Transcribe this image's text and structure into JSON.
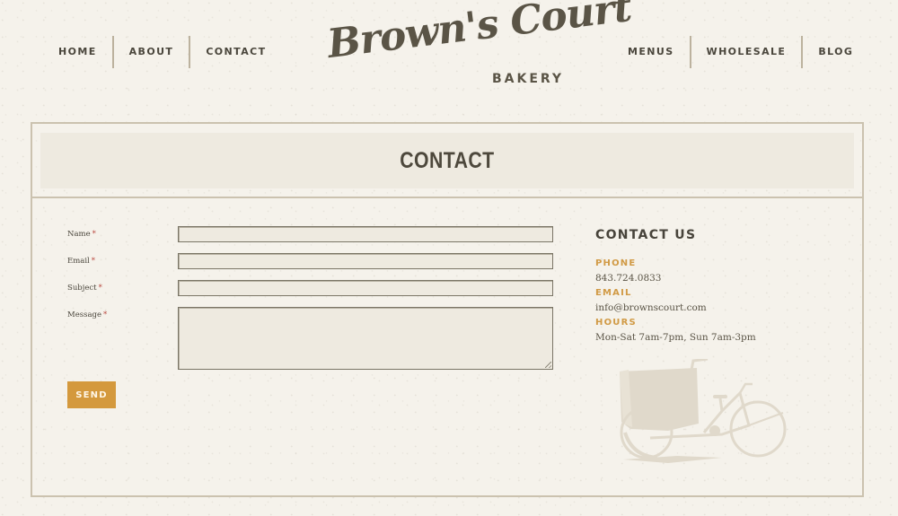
{
  "header": {
    "nav_left": [
      {
        "label": "HOME"
      },
      {
        "label": "ABOUT"
      },
      {
        "label": "CONTACT"
      }
    ],
    "nav_right": [
      {
        "label": "MENUS"
      },
      {
        "label": "WHOLESALE"
      },
      {
        "label": "BLOG"
      }
    ],
    "logo": {
      "script": "Brown's Court",
      "sub": "BAKERY"
    }
  },
  "page": {
    "title": "CONTACT"
  },
  "form": {
    "required_marker": "*",
    "fields": [
      {
        "label": "Name",
        "value": ""
      },
      {
        "label": "Email",
        "value": ""
      },
      {
        "label": "Subject",
        "value": ""
      },
      {
        "label": "Message",
        "value": ""
      }
    ],
    "submit_label": "SEND"
  },
  "contact_info": {
    "heading": "CONTACT US",
    "phone_label": "PHONE",
    "phone": "843.724.0833",
    "email_label": "EMAIL",
    "email": "info@brownscourt.com",
    "hours_label": "HOURS",
    "hours": "Mon-Sat 7am-7pm, Sun 7am-3pm"
  },
  "colors": {
    "background": "#f5f2eb",
    "accent": "#d4993d",
    "text": "#4a463c",
    "border": "#cbc2af",
    "required": "#b8433a"
  },
  "illustration": {
    "name": "cargo-tricycle-icon"
  }
}
